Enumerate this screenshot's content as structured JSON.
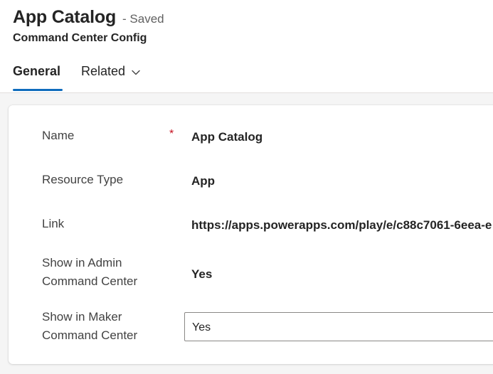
{
  "header": {
    "title": "App Catalog",
    "status": "- Saved",
    "subtitle": "Command Center Config"
  },
  "tabs": {
    "general": "General",
    "related": "Related"
  },
  "form": {
    "required_marker": "*",
    "fields": [
      {
        "label": "Name",
        "value": "App Catalog"
      },
      {
        "label": "Resource Type",
        "value": "App"
      },
      {
        "label": "Link",
        "value": "https://apps.powerapps.com/play/e/c88c7061-6eea-e"
      },
      {
        "label_line1": "Show in Admin",
        "label_line2": "Command Center",
        "value": "Yes"
      },
      {
        "label_line1": "Show in Maker",
        "label_line2": "Command Center",
        "value": "Yes"
      }
    ]
  },
  "colors": {
    "accent": "#0f6cbd",
    "required": "#c50f1f"
  },
  "icons": {
    "related_dropdown": "chevron-down-icon"
  }
}
